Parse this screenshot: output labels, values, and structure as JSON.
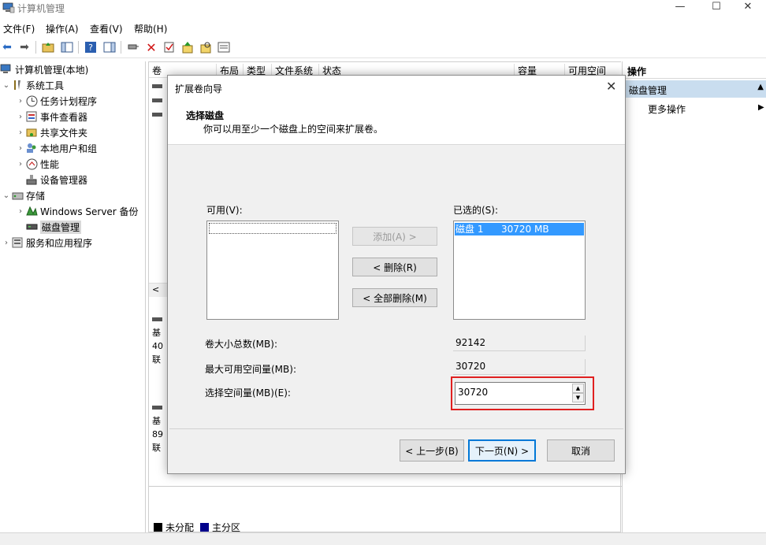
{
  "window": {
    "title": "计算机管理",
    "minimize": "—",
    "maximize": "☐",
    "close": "✕"
  },
  "menu": [
    "文件(F)",
    "操作(A)",
    "查看(V)",
    "帮助(H)"
  ],
  "tree": {
    "root": "计算机管理(本地)",
    "system_tools": "系统工具",
    "task_scheduler": "任务计划程序",
    "event_viewer": "事件查看器",
    "shared_folders": "共享文件夹",
    "local_users": "本地用户和组",
    "performance": "性能",
    "device_manager": "设备管理器",
    "storage": "存储",
    "windows_backup": "Windows Server 备份",
    "disk_management": "磁盘管理",
    "services_apps": "服务和应用程序"
  },
  "columns": [
    "卷",
    "布局",
    "类型",
    "文件系统",
    "状态",
    "容量",
    "可用空间"
  ],
  "disk_rows": {
    "row1": [
      "基",
      "40",
      "联"
    ],
    "row2": [
      "基",
      "89",
      "联"
    ]
  },
  "legend": {
    "unallocated": "未分配",
    "primary": "主分区",
    "unallocated_color": "#000000",
    "primary_color": "#00008b"
  },
  "actions": {
    "header": "操作",
    "section": "磁盘管理",
    "more": "更多操作"
  },
  "dialog": {
    "title": "扩展卷向导",
    "heading": "选择磁盘",
    "subheading": "你可以用至少一个磁盘上的空间来扩展卷。",
    "available_label": "可用(V):",
    "selected_label": "已选的(S):",
    "selected_item_name": "磁盘 1",
    "selected_item_size": "30720 MB",
    "add_button": "添加(A) >",
    "remove_button": "< 删除(R)",
    "remove_all_button": "< 全部删除(M)",
    "total_size_label": "卷大小总数(MB):",
    "total_size_value": "92142",
    "max_space_label": "最大可用空间量(MB):",
    "max_space_value": "30720",
    "select_space_label": "选择空间量(MB)(E):",
    "select_space_value": "30720",
    "back_button": "< 上一步(B)",
    "next_button": "下一页(N) >",
    "cancel_button": "取消"
  },
  "colors": {
    "selection": "#3399ff",
    "highlight_box": "#e02020",
    "action_section": "#c9ddef"
  }
}
